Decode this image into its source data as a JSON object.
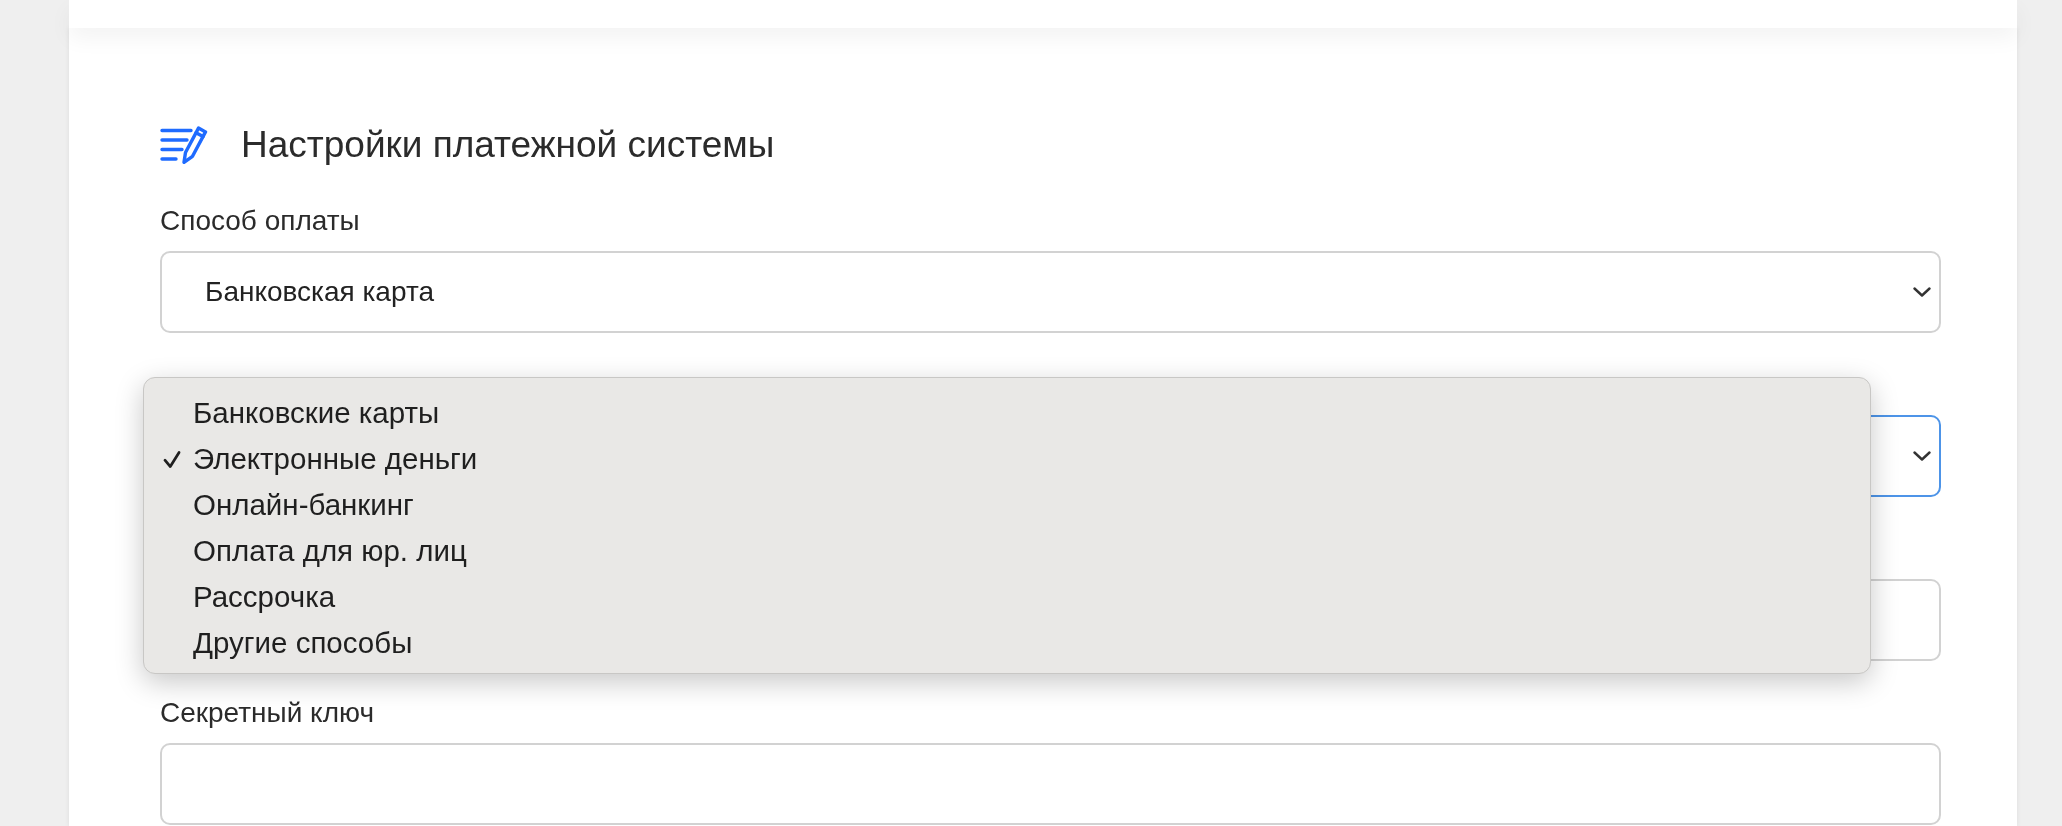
{
  "section": {
    "title": "Настройки платежной системы",
    "fields": [
      {
        "kind": "select",
        "label": "Способ оплаты",
        "value": "Банковская карта",
        "focused": false,
        "expanded": false
      },
      {
        "kind": "select",
        "focused": true,
        "expanded": true,
        "options": [
          {
            "label": "Банковские карты",
            "selected": false
          },
          {
            "label": "Электронные деньги",
            "selected": true
          },
          {
            "label": "Онлайн-банкинг",
            "selected": false
          },
          {
            "label": "Оплата для юр. лиц",
            "selected": false
          },
          {
            "label": "Рассрочка",
            "selected": false
          },
          {
            "label": "Другие способы",
            "selected": false
          }
        ]
      },
      {
        "kind": "input"
      },
      {
        "kind": "input",
        "label": "Секретный ключ"
      }
    ]
  }
}
